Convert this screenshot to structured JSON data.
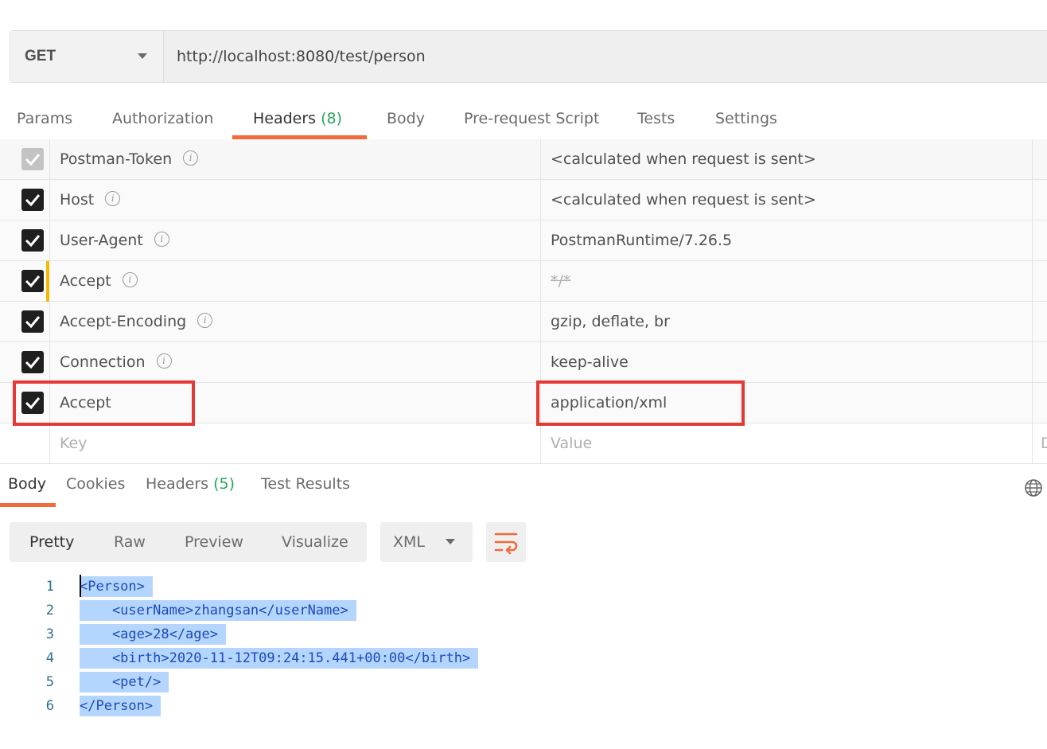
{
  "request": {
    "method": "GET",
    "url": "http://localhost:8080/test/person"
  },
  "request_tabs": [
    {
      "label": "Params"
    },
    {
      "label": "Authorization"
    },
    {
      "label": "Headers",
      "count": "(8)"
    },
    {
      "label": "Body"
    },
    {
      "label": "Pre-request Script"
    },
    {
      "label": "Tests"
    },
    {
      "label": "Settings"
    }
  ],
  "headers": [
    {
      "key": "Postman-Token",
      "value": "<calculated when request is sent>",
      "checked": true,
      "disabled": true
    },
    {
      "key": "Host",
      "value": "<calculated when request is sent>",
      "checked": true
    },
    {
      "key": "User-Agent",
      "value": "PostmanRuntime/7.26.5",
      "checked": true
    },
    {
      "key": "Accept",
      "value": "*/*",
      "checked": true,
      "overridden": true
    },
    {
      "key": "Accept-Encoding",
      "value": "gzip, deflate, br",
      "checked": true
    },
    {
      "key": "Connection",
      "value": "keep-alive",
      "checked": true
    },
    {
      "key": "Accept",
      "value": "application/xml",
      "checked": true,
      "highlighted": true
    }
  ],
  "new_header": {
    "key_placeholder": "Key",
    "value_placeholder": "Value",
    "desc_placeholder": "D"
  },
  "response_tabs": [
    {
      "label": "Body"
    },
    {
      "label": "Cookies"
    },
    {
      "label": "Headers",
      "count": "(5)"
    },
    {
      "label": "Test Results"
    }
  ],
  "view_modes": [
    "Pretty",
    "Raw",
    "Preview",
    "Visualize"
  ],
  "format": "XML",
  "code_lines": [
    {
      "num": "1",
      "text": "<Person>"
    },
    {
      "num": "2",
      "text": "    <userName>zhangsan</userName>"
    },
    {
      "num": "3",
      "text": "    <age>28</age>"
    },
    {
      "num": "4",
      "text": "    <birth>2020-11-12T09:24:15.441+00:00</birth>"
    },
    {
      "num": "5",
      "text": "    <pet/>"
    },
    {
      "num": "6",
      "text": "</Person>"
    }
  ],
  "colors": {
    "accent": "#f26b3a",
    "count": "#26a65b",
    "highlight": "#e53935",
    "selection": "#b4d5fe"
  }
}
